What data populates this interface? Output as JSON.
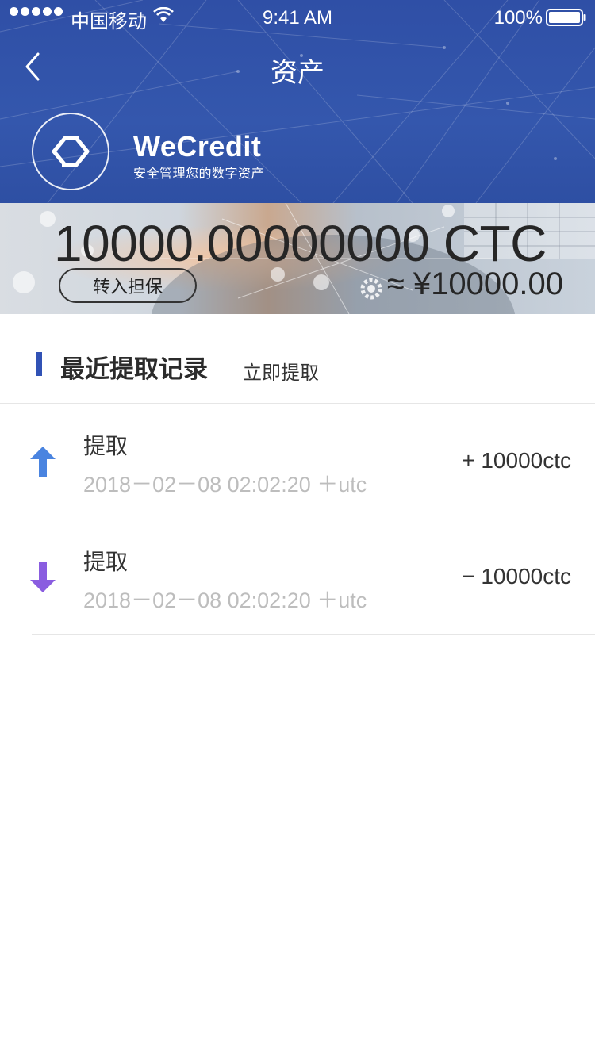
{
  "status_bar": {
    "carrier": "中国移动",
    "time": "9:41 AM",
    "battery": "100%"
  },
  "nav": {
    "title": "资产"
  },
  "brand": {
    "name": "WeCredit",
    "tagline": "安全管理您的数字资产"
  },
  "balance": {
    "amount": "10000.00000000 CTC",
    "fiat": "≈ ¥10000.00",
    "deposit_label": "转入担保"
  },
  "section": {
    "title": "最近提取记录",
    "action_label": "立即提取"
  },
  "records": [
    {
      "title": "提取",
      "time": "2018－02－08  02:02:20  ＋utc",
      "amount": "+ 10000ctc",
      "direction": "up",
      "arrow_color": "#4a84e0"
    },
    {
      "title": "提取",
      "time": "2018－02－08  02:02:20  ＋utc",
      "amount": "− 10000ctc",
      "direction": "down",
      "arrow_color": "#8a5de0"
    }
  ],
  "colors": {
    "header": "#3457ad",
    "accent_bar": "#3152b5"
  }
}
